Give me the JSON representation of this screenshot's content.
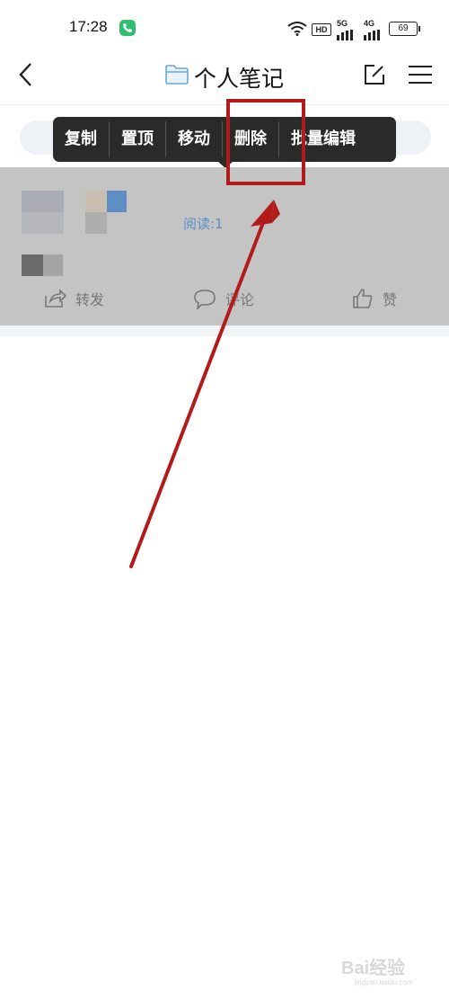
{
  "status": {
    "time": "17:28",
    "hd": "HD",
    "sig1": "5G",
    "sig2": "4G",
    "battery": "69"
  },
  "header": {
    "title": "个人笔记"
  },
  "context_menu": {
    "items": [
      "复制",
      "置顶",
      "移动",
      "删除",
      "批量编辑"
    ]
  },
  "card": {
    "read_count": "阅读:1",
    "share": "转发",
    "comment": "评论",
    "like": "赞"
  },
  "annotation": {
    "highlight_color": "#b31b1b"
  },
  "watermark": {
    "brand": "Bai经验",
    "url": "jingyan.baidu.com"
  }
}
